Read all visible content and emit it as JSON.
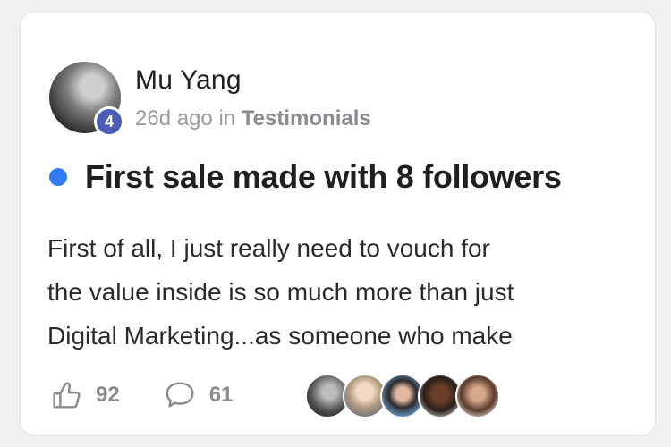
{
  "post": {
    "author": {
      "name": "Mu Yang",
      "level": "4",
      "avatar_icon": "author-avatar"
    },
    "meta": {
      "time_ago": "26d ago",
      "in_word": "in",
      "category": "Testimonials"
    },
    "title": "First sale made with 8 followers",
    "body_lines": [
      "First of all, I just really need to vouch for",
      "the value inside is so much more than just",
      "Digital Marketing...as someone who make"
    ],
    "likes": "92",
    "comments": "61",
    "participants_count_shown": 5
  },
  "colors": {
    "unread_dot": "#2f7cf6",
    "level_badge": "#4b5bb8",
    "meta_text": "#9a9aa0"
  }
}
